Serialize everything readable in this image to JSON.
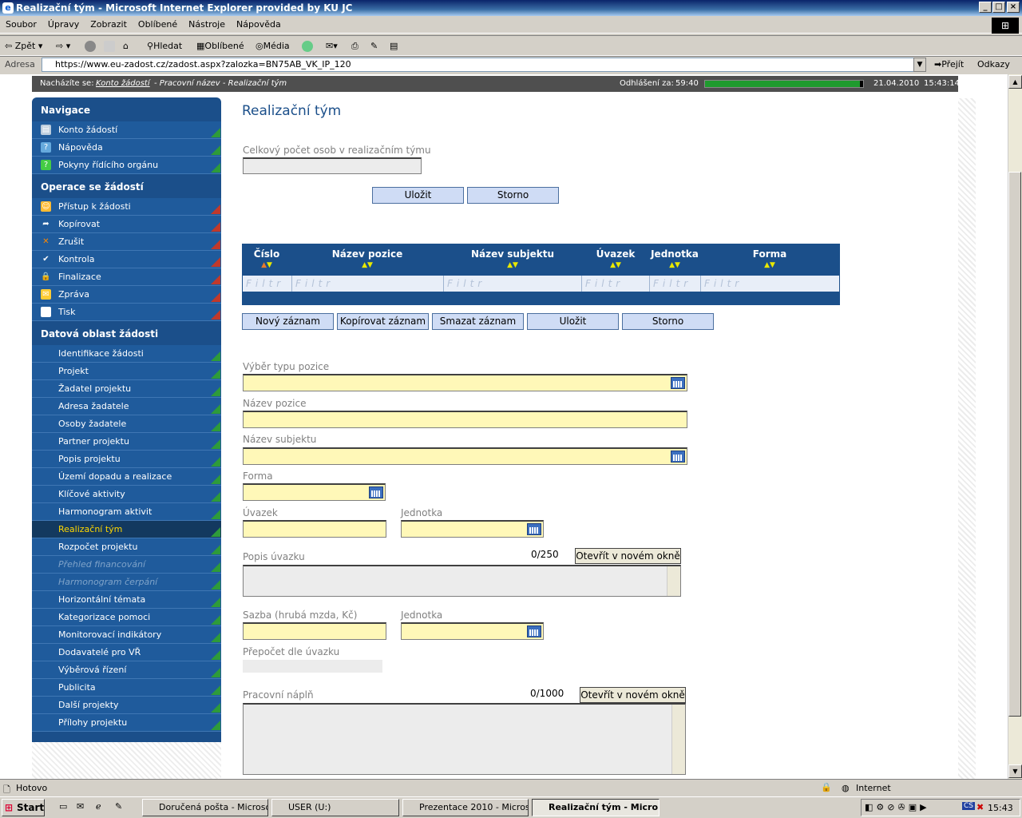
{
  "window": {
    "title": "Realizační tým - Microsoft Internet Explorer provided by KU JC"
  },
  "menu": [
    "Soubor",
    "Úpravy",
    "Zobrazit",
    "Oblíbené",
    "Nástroje",
    "Nápověda"
  ],
  "toolbar": {
    "back": "Zpět",
    "search": "Hledat",
    "favorites": "Oblíbené",
    "media": "Média"
  },
  "address": {
    "label": "Adresa",
    "url": "https://www.eu-zadost.cz/zadost.aspx?zalozka=BN75AB_VK_IP_120",
    "go": "Přejít",
    "links": "Odkazy"
  },
  "topbar": {
    "prefix": "Nacházíte se:",
    "crumb_link": "Konto žádostí",
    "crumb_rest": " - Pracovní název - Realizační tým",
    "logout_label": "Odhlášení za:",
    "logout_time": "59:40",
    "session_progress": 0.98,
    "date": "21.04.2010",
    "time": "15:43:14"
  },
  "sidebar": {
    "sections": [
      {
        "title": "Navigace",
        "items": [
          {
            "label": "Konto žádostí",
            "icon": "account-icon"
          },
          {
            "label": "Nápověda",
            "icon": "help-icon"
          },
          {
            "label": "Pokyny řídícího orgánu",
            "icon": "guidelines-icon"
          }
        ]
      },
      {
        "title": "Operace se žádostí",
        "items": [
          {
            "label": "Přístup k žádosti",
            "icon": "access-icon"
          },
          {
            "label": "Kopírovat",
            "icon": "copy-icon"
          },
          {
            "label": "Zrušit",
            "icon": "cancel-icon"
          },
          {
            "label": "Kontrola",
            "icon": "check-icon"
          },
          {
            "label": "Finalizace",
            "icon": "lock-icon"
          },
          {
            "label": "Zpráva",
            "icon": "message-icon"
          },
          {
            "label": "Tisk",
            "icon": "print-icon"
          }
        ]
      },
      {
        "title": "Datová oblast žádosti",
        "items": [
          {
            "label": "Identifikace žádosti"
          },
          {
            "label": "Projekt"
          },
          {
            "label": "Žadatel projektu"
          },
          {
            "label": "Adresa žadatele"
          },
          {
            "label": "Osoby žadatele"
          },
          {
            "label": "Partner projektu"
          },
          {
            "label": "Popis projektu"
          },
          {
            "label": "Území dopadu a realizace"
          },
          {
            "label": "Klíčové aktivity"
          },
          {
            "label": "Harmonogram aktivit"
          },
          {
            "label": "Realizační tým",
            "active": true
          },
          {
            "label": "Rozpočet projektu"
          },
          {
            "label": "Přehled financování",
            "disabled": true
          },
          {
            "label": "Harmonogram čerpání",
            "disabled": true
          },
          {
            "label": "Horizontální témata"
          },
          {
            "label": "Kategorizace pomoci"
          },
          {
            "label": "Monitorovací indikátory"
          },
          {
            "label": "Dodavatelé pro VŘ"
          },
          {
            "label": "Výběrová řízení"
          },
          {
            "label": "Publicita"
          },
          {
            "label": "Další projekty"
          },
          {
            "label": "Přílohy projektu"
          }
        ]
      }
    ]
  },
  "main": {
    "title": "Realizační tým",
    "total_label": "Celkový počet osob v realizačním týmu",
    "save": "Uložit",
    "cancel": "Storno",
    "grid": {
      "columns": [
        "Číslo",
        "Název pozice",
        "Název subjektu",
        "Úvazek",
        "Jednotka",
        "Forma"
      ],
      "filter": "Filtr"
    },
    "buttons": {
      "new": "Nový záznam",
      "copy": "Kopírovat záznam",
      "delete": "Smazat záznam",
      "save": "Uložit",
      "cancel": "Storno"
    },
    "form": {
      "position_type": "Výběr typu pozice",
      "position_name": "Název pozice",
      "subject_name": "Název subjektu",
      "form": "Forma",
      "workload": "Úvazek",
      "unit": "Jednotka",
      "workload_desc": "Popis úvazku",
      "workload_desc_counter": "0/250",
      "open_new_window": "Otevřít v novém okně",
      "rate": "Sazba (hrubá mzda, Kč)",
      "rate_unit": "Jednotka",
      "recalc": "Přepočet dle úvazku",
      "work_content": "Pracovní náplň",
      "work_content_counter": "0/1000"
    }
  },
  "statusbar": {
    "status": "Hotovo",
    "zone": "Internet"
  },
  "taskbar": {
    "start": "Start",
    "tasks": [
      "Doručená pošta - Microso...",
      "USER (U:)",
      "Prezentace 2010 - Micros...",
      "Realizační tým - Micro..."
    ],
    "clock": "15:43"
  },
  "colors": {
    "sidebar": "#1b4f8a",
    "field": "#fff8b8",
    "button": "#cfdcf5",
    "active_nav": "#ffd700"
  }
}
